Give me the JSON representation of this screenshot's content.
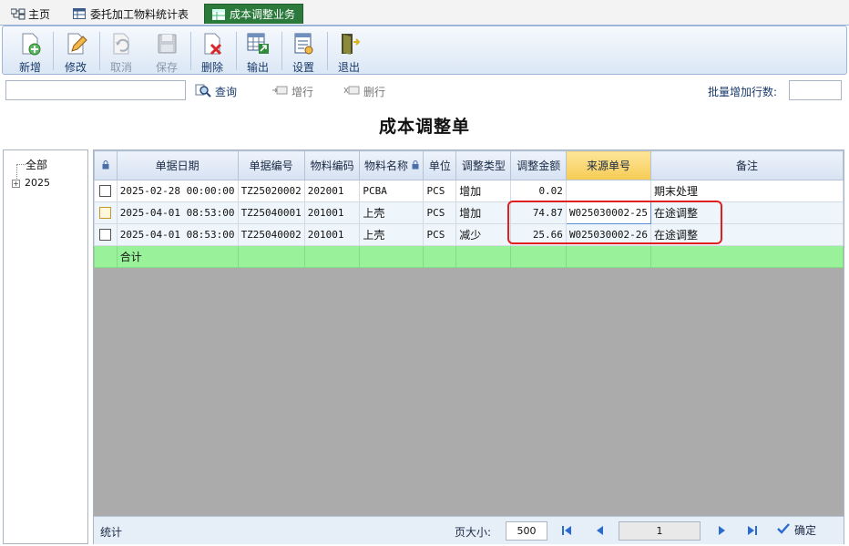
{
  "tabs": [
    {
      "label": "主页",
      "icon": "home-icon"
    },
    {
      "label": "委托加工物料统计表",
      "icon": "table-icon"
    },
    {
      "label": "成本调整业务",
      "icon": "table-icon",
      "active": true
    }
  ],
  "toolbar": {
    "new": "新增",
    "edit": "修改",
    "cancel": "取消",
    "save": "保存",
    "delete": "删除",
    "export": "输出",
    "settings": "设置",
    "exit": "退出"
  },
  "search": {
    "placeholder": "",
    "query": "查询",
    "add_row": "增行",
    "delete_row": "删行",
    "batch_label": "批量增加行数:",
    "batch_value": ""
  },
  "page_title": "成本调整单",
  "tree": {
    "all": "全部",
    "year": "2025"
  },
  "grid": {
    "headers": [
      "单据日期",
      "单据编号",
      "物料编码",
      "物料名称",
      "单位",
      "调整类型",
      "调整金额",
      "来源单号",
      "备注"
    ],
    "rows": [
      {
        "date": "2025-02-28 00:00:00",
        "doc_no": "TZ25020002",
        "mat_code": "202001",
        "mat_name": "PCBA",
        "unit": "PCS",
        "adj_type": "增加",
        "amount": "0.02",
        "source_no": "",
        "remark": "期末处理"
      },
      {
        "date": "2025-04-01 08:53:00",
        "doc_no": "TZ25040001",
        "mat_code": "201001",
        "mat_name": "上壳",
        "unit": "PCS",
        "adj_type": "增加",
        "amount": "74.87",
        "source_no": "W025030002-25",
        "remark": "在途调整"
      },
      {
        "date": "2025-04-01 08:53:00",
        "doc_no": "TZ25040002",
        "mat_code": "201001",
        "mat_name": "上壳",
        "unit": "PCS",
        "adj_type": "减少",
        "amount": "25.66",
        "source_no": "W025030002-26",
        "remark": "在途调整"
      }
    ],
    "total_label": "合计"
  },
  "footer": {
    "stat": "统计",
    "pagesize_label": "页大小:",
    "pagesize": "500",
    "page": "1",
    "confirm": "确定"
  },
  "colors": {
    "accent_tab": "#2b7a3c",
    "total_row": "#99f299",
    "header_highlight": "#f7cb54",
    "annotation": "#e02020"
  }
}
